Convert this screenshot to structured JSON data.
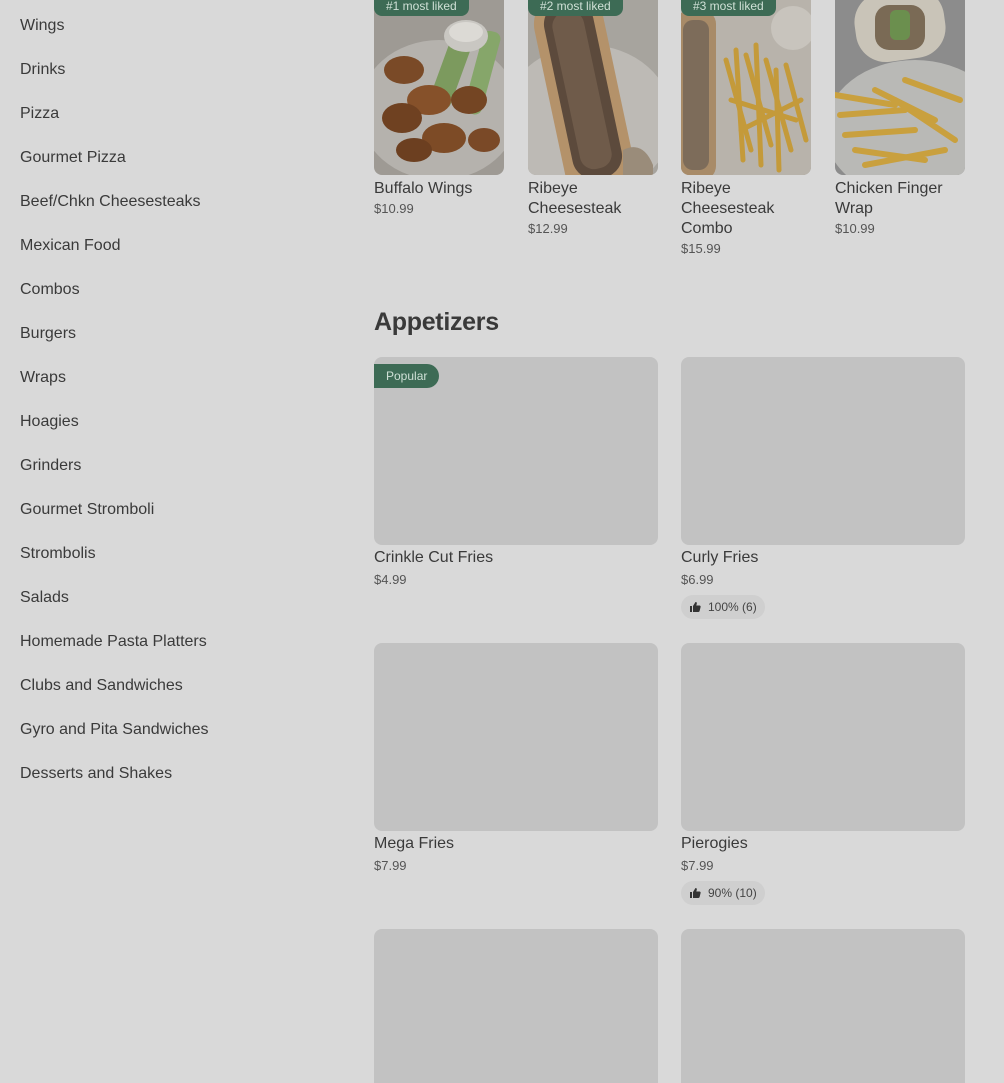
{
  "sidebar": {
    "items": [
      {
        "label": "Wings"
      },
      {
        "label": "Drinks"
      },
      {
        "label": "Pizza"
      },
      {
        "label": "Gourmet Pizza"
      },
      {
        "label": "Beef/Chkn Cheesesteaks"
      },
      {
        "label": "Mexican Food"
      },
      {
        "label": "Combos"
      },
      {
        "label": "Burgers"
      },
      {
        "label": "Wraps"
      },
      {
        "label": "Hoagies"
      },
      {
        "label": "Grinders"
      },
      {
        "label": "Gourmet Stromboli"
      },
      {
        "label": "Strombolis"
      },
      {
        "label": "Salads"
      },
      {
        "label": "Homemade Pasta Platters"
      },
      {
        "label": "Clubs and Sandwiches"
      },
      {
        "label": "Gyro and Pita Sandwiches"
      },
      {
        "label": "Desserts and Shakes"
      }
    ]
  },
  "most_liked": [
    {
      "badge": "#1 most liked",
      "name": "Buffalo Wings",
      "price": "$10.99",
      "image": "buffalo-wings-photo"
    },
    {
      "badge": "#2 most liked",
      "name": "Ribeye Cheesesteak",
      "price": "$12.99",
      "image": "cheesesteak-photo"
    },
    {
      "badge": "#3 most liked",
      "name": "Ribeye Cheesesteak Combo",
      "price": "$15.99",
      "image": "cheesesteak-combo-photo"
    },
    {
      "badge": "",
      "name": "Chicken Finger Wrap",
      "price": "$10.99",
      "image": "chicken-wrap-photo"
    }
  ],
  "appetizers": {
    "title": "Appetizers",
    "items": [
      {
        "name": "Crinkle Cut Fries",
        "price": "$4.99",
        "badge": "Popular",
        "rating": ""
      },
      {
        "name": "Curly Fries",
        "price": "$6.99",
        "badge": "",
        "rating": "100% (6)"
      },
      {
        "name": "Mega Fries",
        "price": "$7.99",
        "badge": "",
        "rating": ""
      },
      {
        "name": "Pierogies",
        "price": "$7.99",
        "badge": "",
        "rating": "90% (10)"
      }
    ]
  },
  "icons": {
    "rating": "thumbs-up-icon"
  },
  "colors": {
    "background": "#d9d9d9",
    "badge": "#3d6b55",
    "image_placeholder": "#c2c2c2"
  }
}
